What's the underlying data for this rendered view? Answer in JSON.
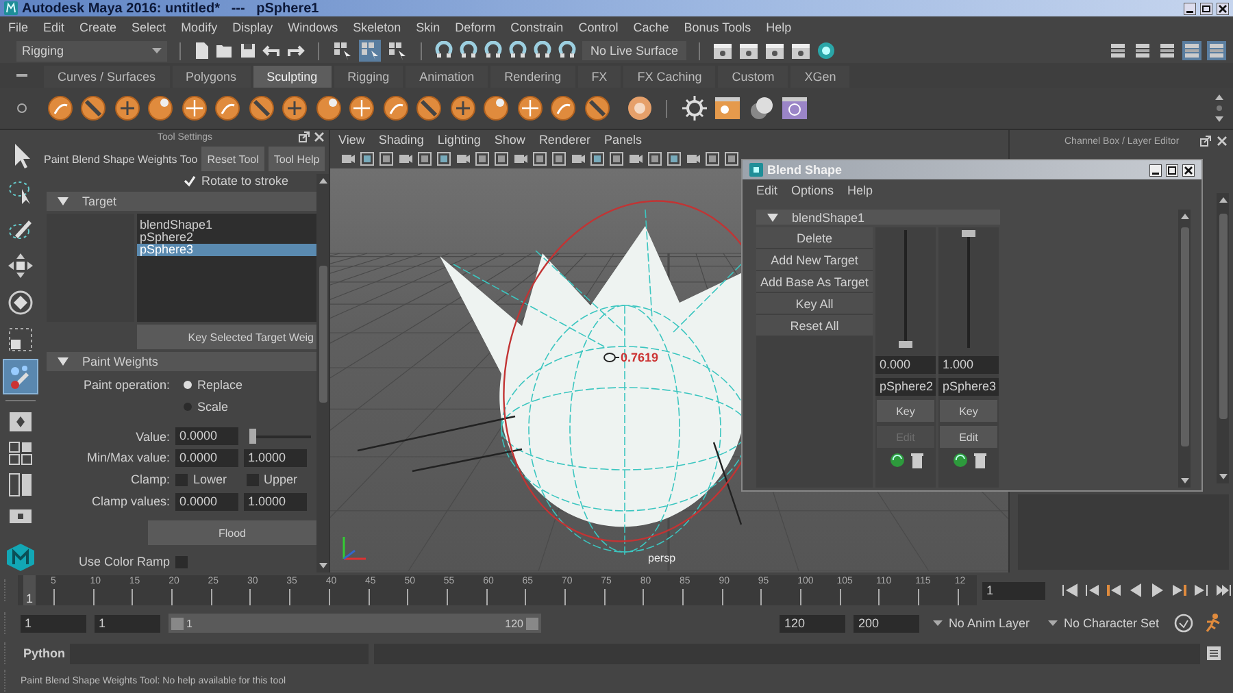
{
  "window": {
    "title": "Autodesk Maya 2016: untitled*   ---   pSphere1"
  },
  "menu_bar": [
    "File",
    "Edit",
    "Create",
    "Select",
    "Modify",
    "Display",
    "Windows",
    "Skeleton",
    "Skin",
    "Deform",
    "Constrain",
    "Control",
    "Cache",
    "Bonus Tools",
    "Help"
  ],
  "status_line": {
    "menu_set": "Rigging",
    "live_surface": "No Live Surface",
    "selection_modes": [
      {
        "selected": false
      },
      {
        "selected": true
      },
      {
        "selected": false
      }
    ],
    "panel_toggles": [
      {
        "on": false
      },
      {
        "on": false
      },
      {
        "on": false
      },
      {
        "on": true
      },
      {
        "on": true
      }
    ]
  },
  "shelf": {
    "tabs": [
      {
        "label": "Curves / Surfaces",
        "selected": false
      },
      {
        "label": "Polygons",
        "selected": false
      },
      {
        "label": "Sculpting",
        "selected": true
      },
      {
        "label": "Rigging",
        "selected": false
      },
      {
        "label": "Animation",
        "selected": false
      },
      {
        "label": "Rendering",
        "selected": false
      },
      {
        "label": "FX",
        "selected": false
      },
      {
        "label": "FX Caching",
        "selected": false
      },
      {
        "label": "Custom",
        "selected": false
      },
      {
        "label": "XGen",
        "selected": false
      }
    ]
  },
  "toolbox": [
    {
      "kind": "select",
      "selected": false
    },
    {
      "kind": "lasso",
      "selected": false
    },
    {
      "kind": "paint",
      "selected": false
    },
    {
      "kind": "move",
      "selected": false
    },
    {
      "kind": "rotate",
      "selected": false
    },
    {
      "kind": "scale",
      "selected": false
    },
    {
      "kind": "sculpt",
      "selected": true
    }
  ],
  "layouts": [
    {
      "kind": "single"
    },
    {
      "kind": "four"
    },
    {
      "kind": "split"
    },
    {
      "kind": "wide"
    }
  ],
  "tool_settings": {
    "header": "Tool Settings",
    "tool_name": "Paint Blend Shape Weights Too",
    "reset_button": "Reset Tool",
    "help_button": "Tool Help",
    "rotate_to_stroke": {
      "label": "Rotate to stroke",
      "checked": true
    },
    "target_section": {
      "title": "Target",
      "expanded": true,
      "items": [
        {
          "label": "blendShape1",
          "selected": false
        },
        {
          "label": "pSphere2",
          "selected": false
        },
        {
          "label": "pSphere3",
          "selected": true
        }
      ],
      "key_button": "Key Selected Target Weig"
    },
    "weights_section": {
      "title": "Paint Weights",
      "expanded": true,
      "operation_label": "Paint operation:",
      "operations": [
        {
          "label": "Replace",
          "selected": true
        },
        {
          "label": "Scale",
          "selected": false
        }
      ],
      "value_label": "Value:",
      "value": "0.0000",
      "level": 0,
      "minmax_label": "Min/Max value:",
      "min": "0.0000",
      "max": "1.0000",
      "clamp_label": "Clamp:",
      "clamp": [
        {
          "label": "Lower",
          "checked": false
        },
        {
          "label": "Upper",
          "checked": false
        }
      ],
      "clamp_values_label": "Clamp values:",
      "clamp_min": "0.0000",
      "clamp_max": "1.0000",
      "flood_button": "Flood",
      "color_ramp": {
        "label": "Use Color Ramp",
        "checked": false
      }
    }
  },
  "viewport": {
    "menu": [
      "View",
      "Shading",
      "Lighting",
      "Show",
      "Renderer",
      "Panels"
    ],
    "readout": "0.7619",
    "camera": "persp"
  },
  "channel_box": {
    "title": "Channel Box / Layer Editor"
  },
  "blend_shape_window": {
    "title": "Blend Shape",
    "menu": [
      "Edit",
      "Options",
      "Help"
    ],
    "node": "blendShape1",
    "expanded": true,
    "actions": [
      "Delete",
      "Add New Target",
      "Add Base As Target",
      "Key All",
      "Reset All"
    ],
    "targets": [
      {
        "value": "0.000",
        "name": "pSphere2",
        "level": 0,
        "key": "Key",
        "edit": "Edit",
        "edit_disabled": true
      },
      {
        "value": "1.000",
        "name": "pSphere3",
        "level": 1,
        "key": "Key",
        "edit": "Edit",
        "edit_disabled": false
      }
    ]
  },
  "timeline": {
    "current_marker": "1",
    "level": 0,
    "ticks": [
      "5",
      "10",
      "15",
      "20",
      "25",
      "30",
      "35",
      "40",
      "45",
      "50",
      "55",
      "60",
      "65",
      "70",
      "75",
      "80",
      "85",
      "90",
      "95",
      "100",
      "105",
      "110",
      "115",
      "12"
    ],
    "current_frame": "1"
  },
  "range": {
    "level": 1,
    "start": "1",
    "playback_start": "1",
    "slider_start": "1",
    "slider_end": "120",
    "playback_end": "120",
    "end": "200",
    "anim_layer": "No Anim Layer",
    "character_set": "No Character Set"
  },
  "command_line": {
    "language": "Python"
  },
  "help_line": "Paint Blend Shape Weights Tool: No help available for this tool"
}
